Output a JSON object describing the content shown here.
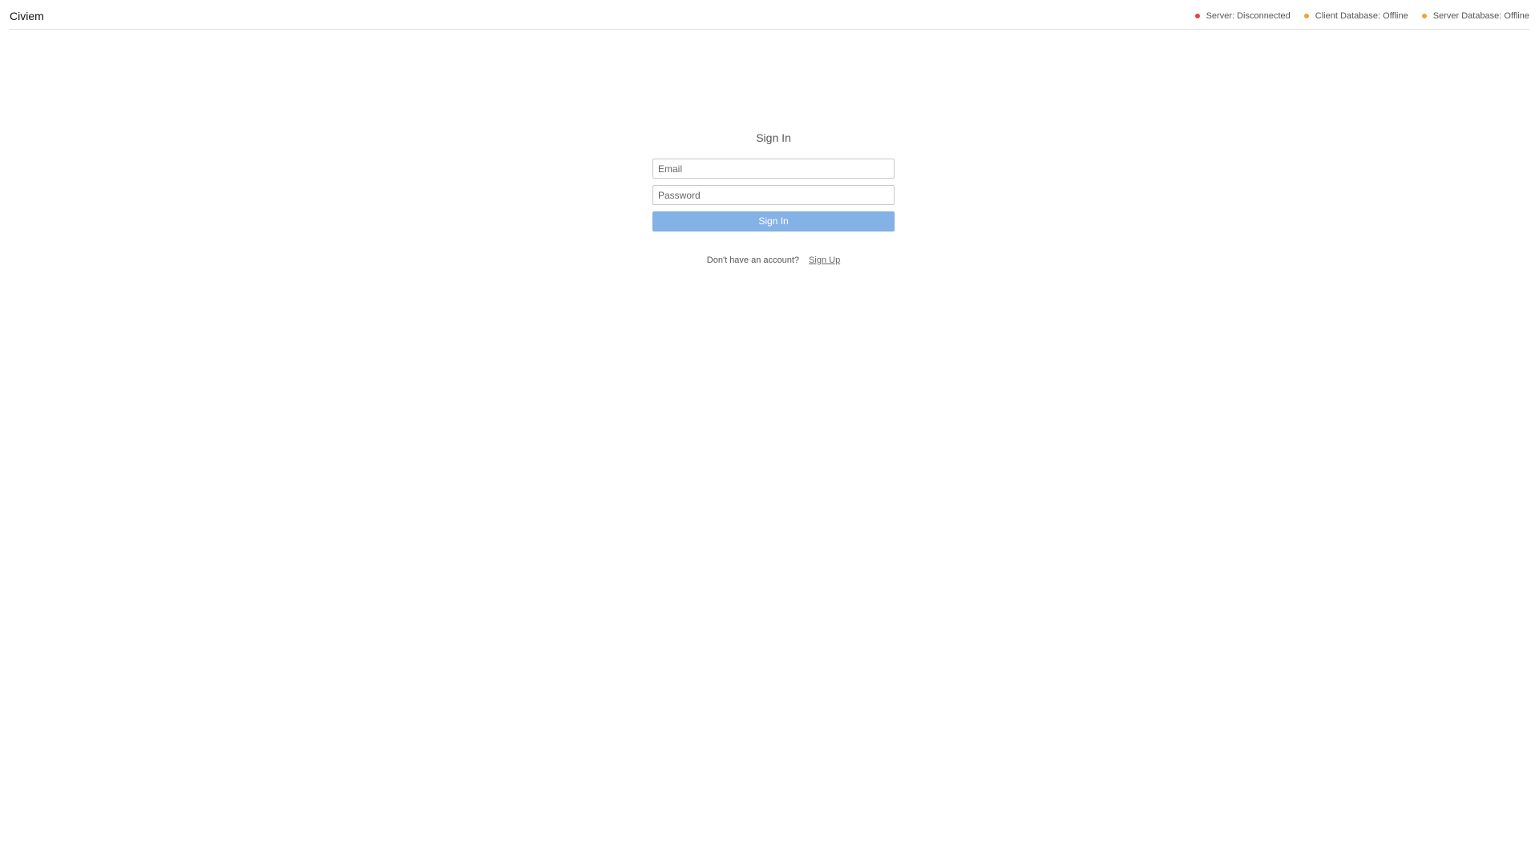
{
  "app": {
    "title": "Civiem"
  },
  "status": [
    {
      "label": "Server: Disconnected",
      "color": "#e44345"
    },
    {
      "label": "Client Database: Offline",
      "color": "#f0a13a"
    },
    {
      "label": "Server Database: Offline",
      "color": "#f0a13a"
    }
  ],
  "signin": {
    "heading": "Sign In",
    "email_placeholder": "Email",
    "password_placeholder": "Password",
    "button_label": "Sign In",
    "signup_prompt": "Don't have an account?",
    "signup_link": "Sign Up"
  },
  "colors": {
    "button_background": "#84b2e6",
    "divider": "#dcdcdc"
  }
}
